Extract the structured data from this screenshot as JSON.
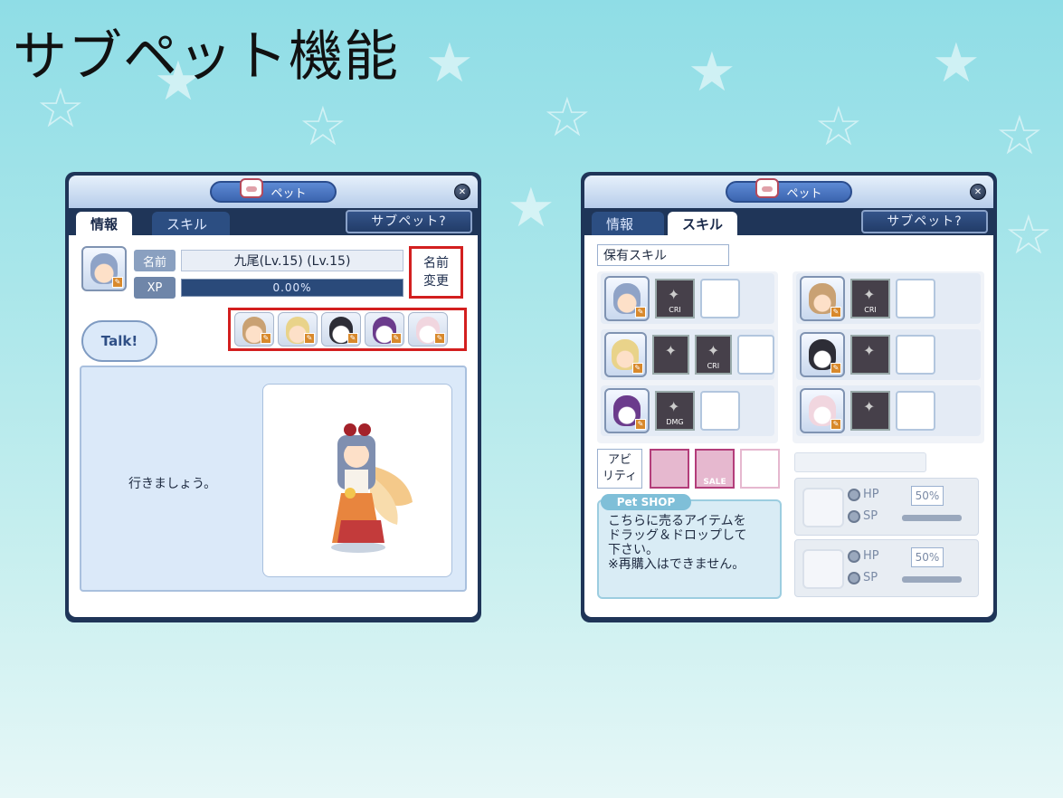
{
  "slide": {
    "title": "サブペット機能"
  },
  "left_window": {
    "title": "ペット",
    "tabs": [
      {
        "label": "情報",
        "active": true
      },
      {
        "label": "スキル",
        "active": false
      }
    ],
    "subpet_button": "サブペット?",
    "name_label": "名前",
    "name_value": "九尾(Lv.15) (Lv.15)",
    "xp_label": "XP",
    "xp_value": "0.00%",
    "rename_button": [
      "名前",
      "変更"
    ],
    "talk_button": "Talk!",
    "dialog_text": "行きましょう。",
    "subpets_count": 5
  },
  "right_window": {
    "title": "ペット",
    "tabs": [
      {
        "label": "情報",
        "active": false
      },
      {
        "label": "スキル",
        "active": true
      }
    ],
    "subpet_button": "サブペット?",
    "owned_skills_label": "保有スキル",
    "skill_icons": [
      "CRI",
      "CRI",
      "DMG",
      "CRI"
    ],
    "ability_label": [
      "アビ",
      "リティ"
    ],
    "ability_sale": "SALE",
    "shop": {
      "title": "Pet SHOP",
      "lines": [
        "こちらに売るアイテムを",
        "ドラッグ＆ドロップして",
        "下さい。",
        "※再購入はできません。"
      ]
    },
    "auto": [
      {
        "hp": "HP",
        "sp": "SP",
        "pct": "50%"
      },
      {
        "hp": "HP",
        "sp": "SP",
        "pct": "50%"
      }
    ]
  },
  "colors": {
    "highlight": "#d31f1f",
    "frame": "#1f3558",
    "accent": "#2c4e82"
  }
}
